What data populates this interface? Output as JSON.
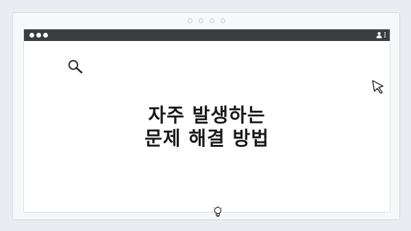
{
  "slide": {
    "title_line1": "자주 발생하는",
    "title_line2": "문제 해결 방법"
  },
  "icons": {
    "search": "search-icon",
    "cursor": "cursor-icon",
    "bulb": "lightbulb-icon",
    "user": "user-icon",
    "menu": "kebab-menu-icon"
  },
  "colors": {
    "titlebar": "#3b3d41",
    "background": "#e9edf2",
    "text": "#1a1a1a"
  }
}
